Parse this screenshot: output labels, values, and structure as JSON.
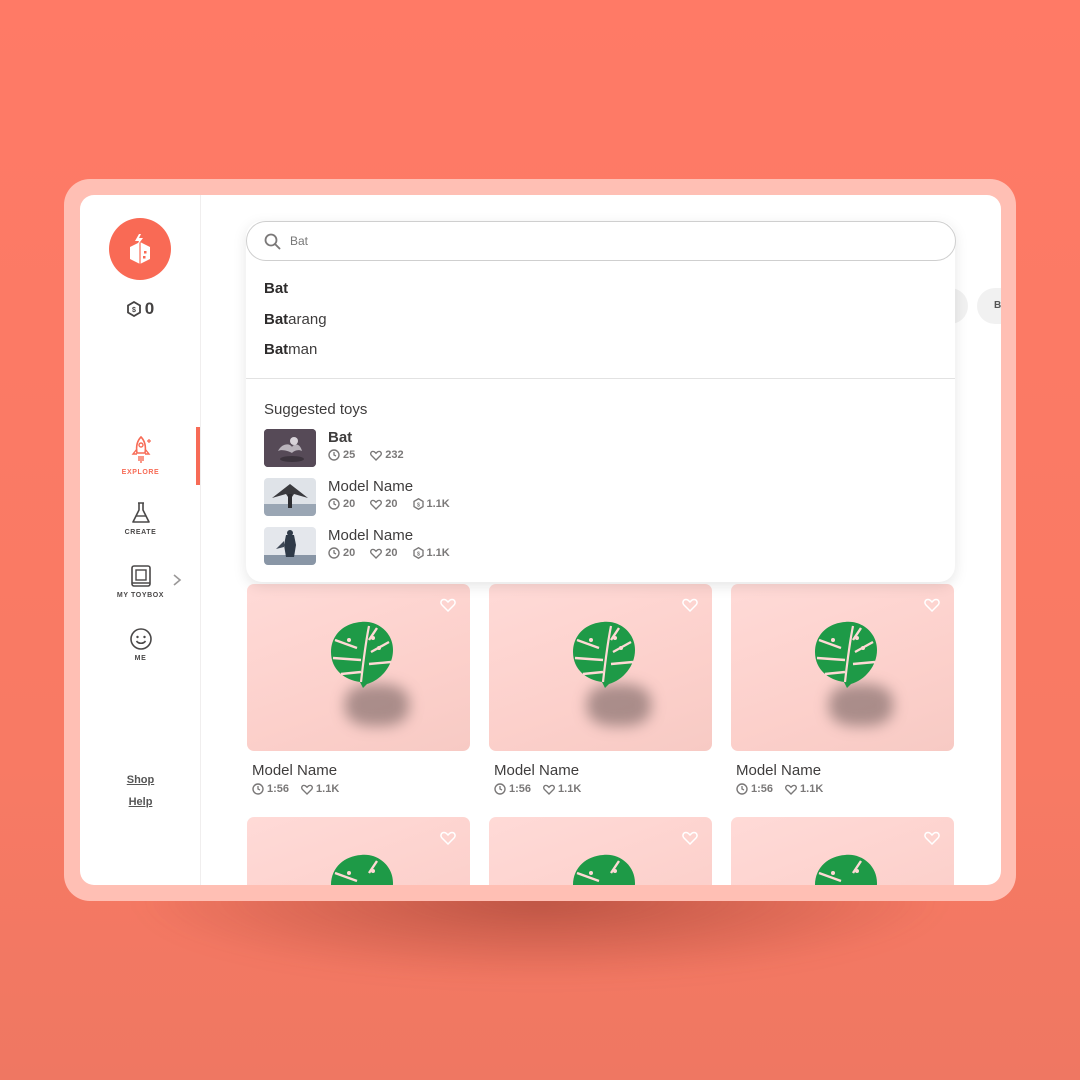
{
  "app": {
    "coins": "0",
    "nav": [
      {
        "label": "EXPLORE",
        "icon": "rocket-icon",
        "active": true
      },
      {
        "label": "CREATE",
        "icon": "flask-icon"
      },
      {
        "label": "MY TOYBOX",
        "icon": "toybox-icon"
      },
      {
        "label": "ME",
        "icon": "smiley-icon"
      }
    ],
    "footer": {
      "shop": "Shop",
      "help": "Help"
    }
  },
  "search": {
    "query": "Bat",
    "suggestions": [
      {
        "match": "Bat",
        "rest": ""
      },
      {
        "match": "Bat",
        "rest": "arang"
      },
      {
        "match": "Bat",
        "rest": "man"
      }
    ],
    "suggested_toys_title": "Suggested toys",
    "toys": [
      {
        "name": "Bat",
        "time": "25",
        "likes": "232"
      },
      {
        "name": "Model Name",
        "time": "20",
        "likes": "20",
        "coins": "1.1K"
      },
      {
        "name": "Model Name",
        "time": "20",
        "likes": "20",
        "coins": "1.1K"
      }
    ]
  },
  "filter_chip_partial": "B",
  "grid": [
    {
      "name": "Model Name",
      "time": "1:56",
      "likes": "1.1K"
    },
    {
      "name": "Model Name",
      "time": "1:56",
      "likes": "1.1K"
    },
    {
      "name": "Model Name",
      "time": "1:56",
      "likes": "1.1K"
    }
  ],
  "colors": {
    "accent": "#f76b56",
    "background": "#ff7a66",
    "leaf": "#1e9a47"
  }
}
